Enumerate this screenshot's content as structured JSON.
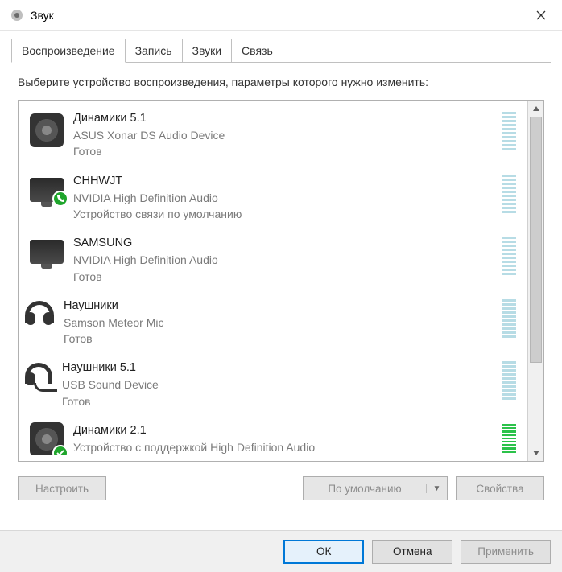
{
  "window": {
    "title": "Звук"
  },
  "tabs": [
    {
      "label": "Воспроизведение",
      "active": true
    },
    {
      "label": "Запись",
      "active": false
    },
    {
      "label": "Звуки",
      "active": false
    },
    {
      "label": "Связь",
      "active": false
    }
  ],
  "instruction": "Выберите устройство воспроизведения, параметры которого нужно изменить:",
  "devices": [
    {
      "icon": "speaker",
      "name": "Динамики 5.1",
      "sub": "ASUS Xonar DS Audio Device",
      "status": "Готов",
      "meter": "idle",
      "badge": null
    },
    {
      "icon": "monitor",
      "name": "CHHWJT",
      "sub": "NVIDIA High Definition Audio",
      "status": "Устройство связи по умолчанию",
      "meter": "idle",
      "badge": "phone"
    },
    {
      "icon": "monitor",
      "name": "SAMSUNG",
      "sub": "NVIDIA High Definition Audio",
      "status": "Готов",
      "meter": "idle",
      "badge": null
    },
    {
      "icon": "headphone",
      "name": "Наушники",
      "sub": "Samson Meteor Mic",
      "status": "Готов",
      "meter": "idle",
      "badge": null
    },
    {
      "icon": "headset",
      "name": "Наушники 5.1",
      "sub": "USB Sound Device",
      "status": "Готов",
      "meter": "idle",
      "badge": null
    },
    {
      "icon": "speaker",
      "name": "Динамики 2.1",
      "sub": "Устройство с поддержкой High Definition Audio",
      "status": "",
      "meter": "active",
      "badge": "check",
      "partial": true
    }
  ],
  "buttons": {
    "configure": "Настроить",
    "set_default": "По умолчанию",
    "properties": "Свойства"
  },
  "footer": {
    "ok": "ОК",
    "cancel": "Отмена",
    "apply": "Применить"
  }
}
